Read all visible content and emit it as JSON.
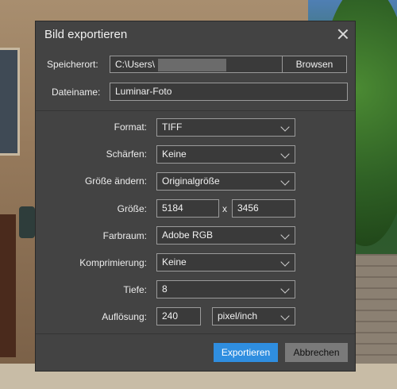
{
  "dialog": {
    "title": "Bild exportieren",
    "location": {
      "label": "Speicherort:",
      "value": "C:\\Users\\",
      "browse_label": "Browsen"
    },
    "filename": {
      "label": "Dateiname:",
      "value": "Luminar-Foto"
    },
    "format": {
      "label": "Format:",
      "value": "TIFF"
    },
    "sharpen": {
      "label": "Schärfen:",
      "value": "Keine"
    },
    "resize": {
      "label": "Größe ändern:",
      "value": "Originalgröße"
    },
    "size": {
      "label": "Größe:",
      "width": "5184",
      "separator": "x",
      "height": "3456"
    },
    "colorspace": {
      "label": "Farbraum:",
      "value": "Adobe RGB"
    },
    "compression": {
      "label": "Komprimierung:",
      "value": "Keine"
    },
    "depth": {
      "label": "Tiefe:",
      "value": "8"
    },
    "resolution": {
      "label": "Auflösung:",
      "value": "240",
      "unit": "pixel/inch"
    },
    "export_label": "Exportieren",
    "cancel_label": "Abbrechen"
  },
  "icons": {
    "close": "close-icon",
    "dropdown": "chevron-down-icon"
  },
  "colors": {
    "dialog_bg": "#434343",
    "primary": "#2f8ee0",
    "secondary": "#7a7a7a"
  }
}
